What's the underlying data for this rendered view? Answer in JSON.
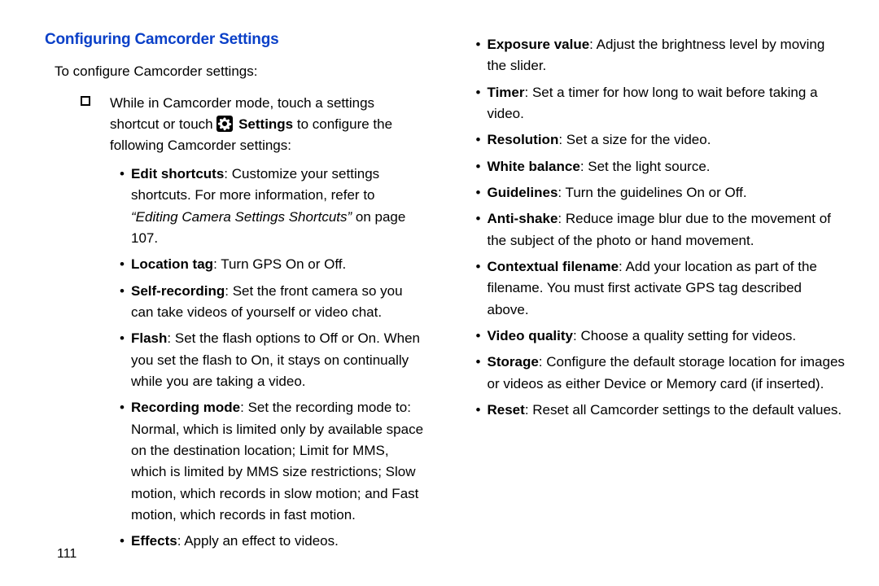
{
  "heading": "Configuring Camcorder Settings",
  "intro": "To configure Camcorder settings:",
  "step_pre": "While in Camcorder mode, touch a settings shortcut or touch ",
  "step_settings_word": "Settings",
  "step_post": " to configure the following Camcorder settings:",
  "left_items": {
    "i0": {
      "label": "Edit shortcuts",
      "text_pre": ": Customize your settings shortcuts. For more information, refer to ",
      "ref_italic": "“Editing Camera Settings Shortcuts”",
      "text_post": " on page 107."
    },
    "i1": {
      "label": "Location tag",
      "text": ": Turn GPS On or Off."
    },
    "i2": {
      "label": "Self-recording",
      "text": ": Set the front camera so you can take videos of yourself or video chat."
    },
    "i3": {
      "label": "Flash",
      "text": ": Set the flash options to Off or On. When you set the flash to On, it stays on continually while you are taking a video."
    },
    "i4": {
      "label": "Recording mode",
      "text": ": Set the recording mode to: Normal, which is limited only by available space on the destination location; Limit for MMS, which is limited by MMS size restrictions; Slow motion, which records in slow motion; and Fast motion, which records in fast motion."
    },
    "i5": {
      "label": "Effects",
      "text": ": Apply an effect to videos."
    }
  },
  "right_items": {
    "i0": {
      "label": "Exposure value",
      "text": ": Adjust the brightness level by moving the slider."
    },
    "i1": {
      "label": "Timer",
      "text": ": Set a timer for how long to wait before taking a video."
    },
    "i2": {
      "label": "Resolution",
      "text": ": Set a size for the video."
    },
    "i3": {
      "label": "White balance",
      "text": ": Set the light source."
    },
    "i4": {
      "label": "Guidelines",
      "text": ": Turn the guidelines On or Off."
    },
    "i5": {
      "label": "Anti-shake",
      "text": ": Reduce image blur due to the movement of the subject of the photo or hand movement."
    },
    "i6": {
      "label": "Contextual filename",
      "text": ": Add your location as part of the filename. You must first activate GPS tag described above."
    },
    "i7": {
      "label": "Video quality",
      "text": ": Choose a quality setting for videos."
    },
    "i8": {
      "label": "Storage",
      "text": ": Configure the default storage location for images or videos as either Device or Memory card (if inserted)."
    },
    "i9": {
      "label": "Reset",
      "text": ": Reset all Camcorder settings to the default values."
    }
  },
  "page_number": "111"
}
